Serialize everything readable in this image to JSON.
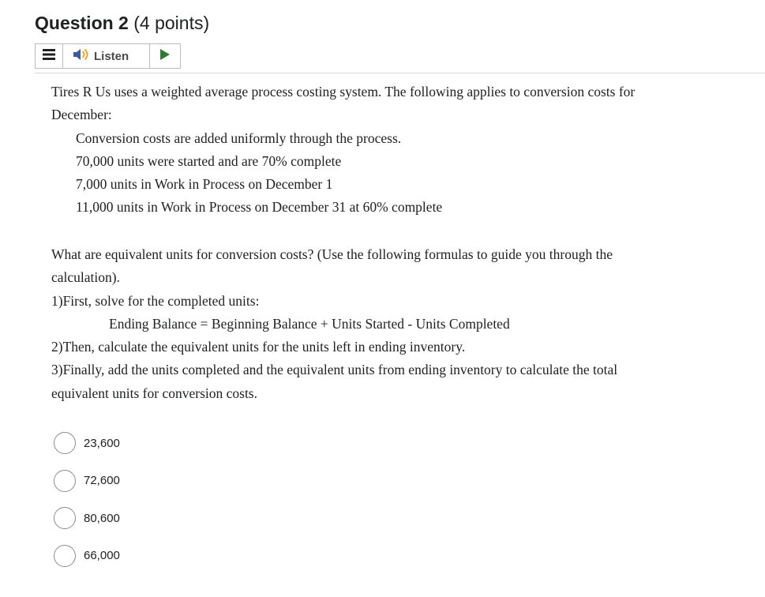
{
  "question": {
    "title": "Question 2",
    "points": "(4 points)"
  },
  "listen_bar": {
    "label": "Listen",
    "menu_icon": "hamburger-menu-icon",
    "speaker_icon": "speaker-icon",
    "play_icon": "play-icon",
    "play_color": "#2e7d32",
    "speaker_color": "#3a5ba0"
  },
  "body": {
    "intro_line1": "Tires R Us uses a weighted average process costing system. The following applies to conversion costs for",
    "intro_line2": "December:",
    "facts": [
      "Conversion costs are added uniformly through the process.",
      "70,000 units were started and are 70% complete",
      "7,000 units in Work in Process on December 1",
      "11,000 units in Work in Process on December 31 at 60% complete"
    ],
    "prompt_line1": "What are equivalent units for conversion costs? (Use the following formulas to guide you through the",
    "prompt_line2": "calculation).",
    "step1": "1)First, solve for the completed units:",
    "formula": "Ending Balance = Beginning Balance + Units Started - Units Completed",
    "step2": "2)Then, calculate the equivalent units for the units left in ending inventory.",
    "step3_line1": "3)Finally, add the units completed and the equivalent units from ending inventory to calculate the total",
    "step3_line2": "equivalent units for conversion costs."
  },
  "choices": [
    {
      "label": "23,600"
    },
    {
      "label": "72,600"
    },
    {
      "label": "80,600"
    },
    {
      "label": "66,000"
    }
  ]
}
